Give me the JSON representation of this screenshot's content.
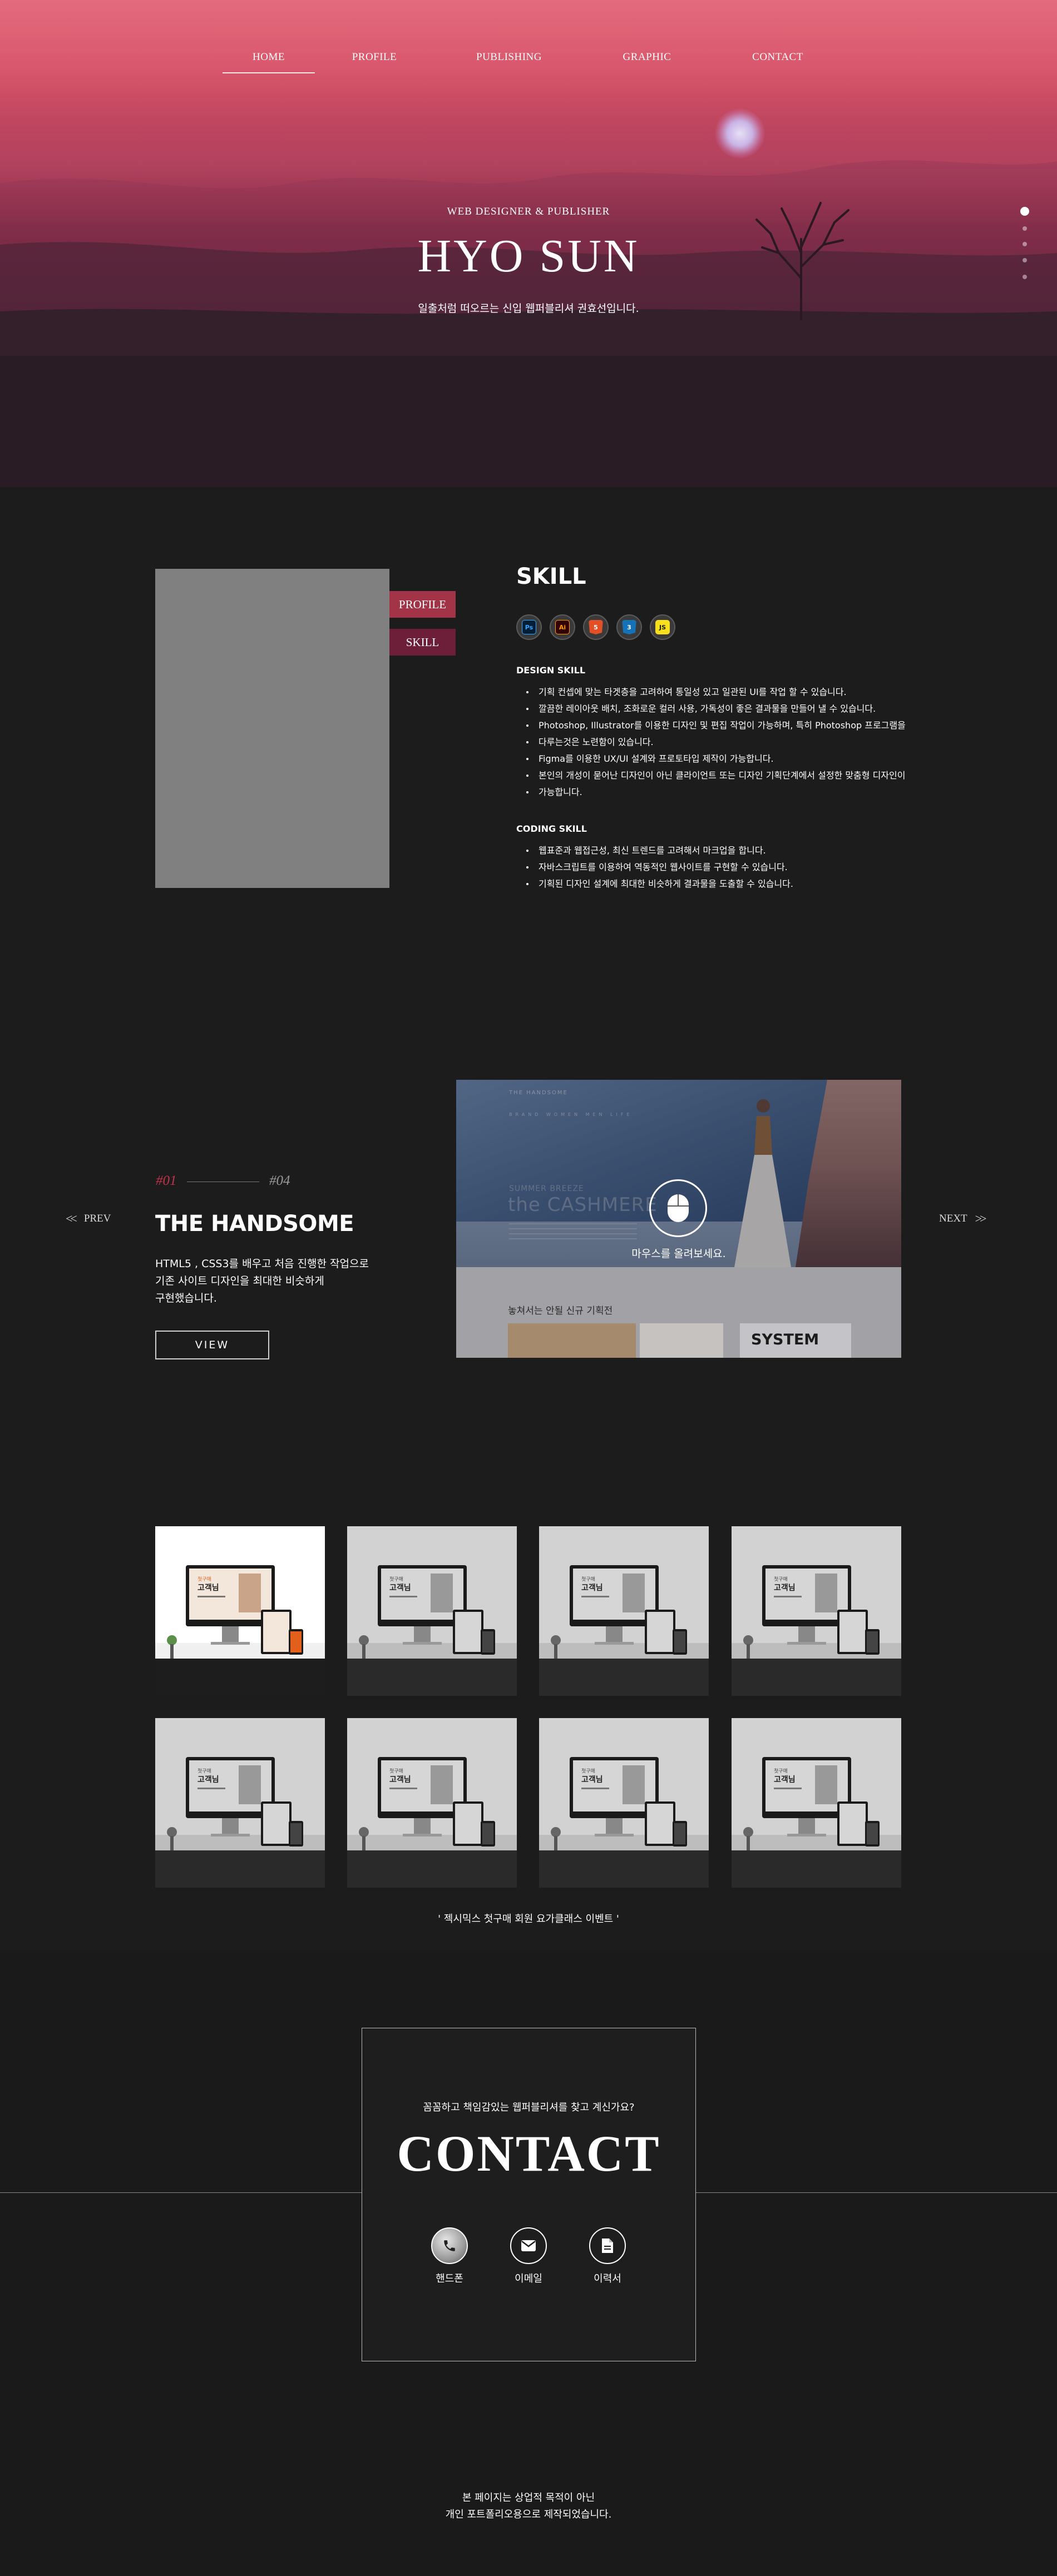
{
  "nav": {
    "items": [
      {
        "label": "HOME",
        "active": true
      },
      {
        "label": "PROFILE",
        "active": false
      },
      {
        "label": "PUBLISHING",
        "active": false
      },
      {
        "label": "GRAPHIC",
        "active": false
      },
      {
        "label": "CONTACT",
        "active": false
      }
    ]
  },
  "hero": {
    "subtitle": "WEB DESIGNER & PUBLISHER",
    "title": "HYO SUN",
    "tagline": "일출처럼 떠오르는 신입 웹퍼블리셔 권효선입니다.",
    "section_dots": 5,
    "active_dot": 1
  },
  "about": {
    "tabs": {
      "profile": "PROFILE",
      "skill": "SKILL"
    },
    "title": "SKILL",
    "skill_icons": [
      {
        "name": "photoshop-icon",
        "label": "Ps",
        "color": "#31a8ff",
        "bg": "#001e36"
      },
      {
        "name": "illustrator-icon",
        "label": "Ai",
        "color": "#ff9a00",
        "bg": "#330000"
      },
      {
        "name": "html5-icon",
        "label": "5",
        "color": "#ffffff",
        "bg": "#e34f26"
      },
      {
        "name": "css3-icon",
        "label": "3",
        "color": "#ffffff",
        "bg": "#1572b6"
      },
      {
        "name": "javascript-icon",
        "label": "JS",
        "color": "#1a1a1a",
        "bg": "#f7df1e"
      }
    ],
    "design_heading": "DESIGN SKILL",
    "design_items": [
      "기획 컨셉에 맞는 타겟층을 고려하여 통일성 있고 일관된 UI를 작업 할 수 있습니다.",
      "깔끔한 레이아웃 배치, 조화로운 컬러 사용, 가독성이 좋은 결과물을 만들어 낼 수 있습니다.",
      "Photoshop, Illustrator를 이용한 디자인 및 편집 작업이 가능하며, 특히 Photoshop 프로그램을",
      "다루는것은 노련함이 있습니다.",
      "Figma를 이용한 UX/UI 설계와 프로토타입 제작이 가능합니다.",
      "본인의 개성이 묻어난 디자인이 아닌 클라이언트 또는 디자인 기획단계에서 설정한 맞춤형 디자인이",
      "가능합니다."
    ],
    "coding_heading": "CODING SKILL",
    "coding_items": [
      "웹표준과 웹접근성, 최신 트렌드를 고려해서 마크업을 합니다.",
      "자바스크립트를 이용하여 역동적인 웹사이트를 구현할 수 있습니다.",
      "기획된 디자인 설계에 최대한 비슷하게 결과물을 도출할 수 있습니다."
    ]
  },
  "project": {
    "prev_label": "PREV",
    "next_label": "NEXT",
    "current": "#01",
    "total": "#04",
    "title": "THE HANDSOME",
    "description_lines": [
      "HTML5 , CSS3를 배우고 처음 진행한 작업으로",
      "기존 사이트 디자인을 최대한 비슷하게",
      "구현했습니다."
    ],
    "view_label": "VIEW",
    "preview": {
      "brand": "THE HANDSOME",
      "menu": "BRAND  WOMEN  MEN  LIFE",
      "small_text": "SUMMER BREEZE",
      "big_text": "the CASHMERE",
      "section_title": "놓쳐서는 안될 신규 기획전",
      "system_label": "SYSTEM"
    },
    "scroll_hint": "마우스를 올려보세요."
  },
  "gallery": {
    "thumbnails": [
      {
        "title_lines": [
          "첫구매",
          "고객님"
        ],
        "color": true
      },
      {
        "title_lines": [
          "첫구매",
          "고객님"
        ],
        "color": false
      },
      {
        "title_lines": [
          "첫구매",
          "고객님"
        ],
        "color": false
      },
      {
        "title_lines": [
          "첫구매",
          "고객님"
        ],
        "color": false
      },
      {
        "title_lines": [
          "첫구매",
          "고객님"
        ],
        "color": false
      },
      {
        "title_lines": [
          "첫구매",
          "고객님"
        ],
        "color": false
      },
      {
        "title_lines": [
          "첫구매",
          "고객님"
        ],
        "color": false
      },
      {
        "title_lines": [
          "첫구매",
          "고객님"
        ],
        "color": false
      }
    ],
    "caption": "' 젝시믹스 첫구매 회원 요가클래스 이벤트 '"
  },
  "contact": {
    "question": "꼼꼼하고 책임감있는 웹퍼블리셔를 찾고 계신가요?",
    "title": "CONTACT",
    "items": [
      {
        "label": "핸드폰",
        "icon": "phone-icon"
      },
      {
        "label": "이메일",
        "icon": "mail-icon"
      },
      {
        "label": "이력서",
        "icon": "document-icon"
      }
    ]
  },
  "footer": {
    "lines": [
      "본 페이지는 상업적 목적이 아닌",
      "개인 포트폴리오용으로 제작되었습니다."
    ]
  },
  "colors": {
    "accent": "#c2324b",
    "tab_profile": "#a33448",
    "tab_skill": "#6d1e38",
    "background": "#1c1c1c"
  }
}
